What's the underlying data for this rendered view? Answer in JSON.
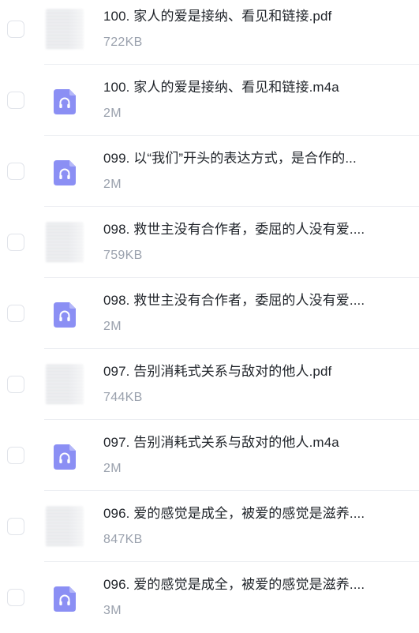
{
  "colors": {
    "audio_icon": "#8b8ff4",
    "name_text": "#1f2329",
    "size_text": "#9aa1ad",
    "divider": "#eceef2"
  },
  "files": [
    {
      "name": "100. 家人的爱是接纳、看见和链接.pdf",
      "size": "722KB",
      "type": "pdf",
      "icon": "pdf-thumbnail"
    },
    {
      "name": "100. 家人的爱是接纳、看见和链接.m4a",
      "size": "2M",
      "type": "audio",
      "icon": "headphones-icon"
    },
    {
      "name": "099. 以“我们”开头的表达方式，是合作的...",
      "size": "2M",
      "type": "audio",
      "icon": "headphones-icon"
    },
    {
      "name": "098. 救世主没有合作者，委屈的人没有爱....",
      "size": "759KB",
      "type": "pdf",
      "icon": "pdf-thumbnail"
    },
    {
      "name": "098. 救世主没有合作者，委屈的人没有爱....",
      "size": "2M",
      "type": "audio",
      "icon": "headphones-icon"
    },
    {
      "name": "097. 告别消耗式关系与敌对的他人.pdf",
      "size": "744KB",
      "type": "pdf",
      "icon": "pdf-thumbnail"
    },
    {
      "name": "097. 告别消耗式关系与敌对的他人.m4a",
      "size": "2M",
      "type": "audio",
      "icon": "headphones-icon"
    },
    {
      "name": "096. 爱的感觉是成全，被爱的感觉是滋养....",
      "size": "847KB",
      "type": "pdf",
      "icon": "pdf-thumbnail"
    },
    {
      "name": "096. 爱的感觉是成全，被爱的感觉是滋养....",
      "size": "3M",
      "type": "audio",
      "icon": "headphones-icon"
    }
  ]
}
